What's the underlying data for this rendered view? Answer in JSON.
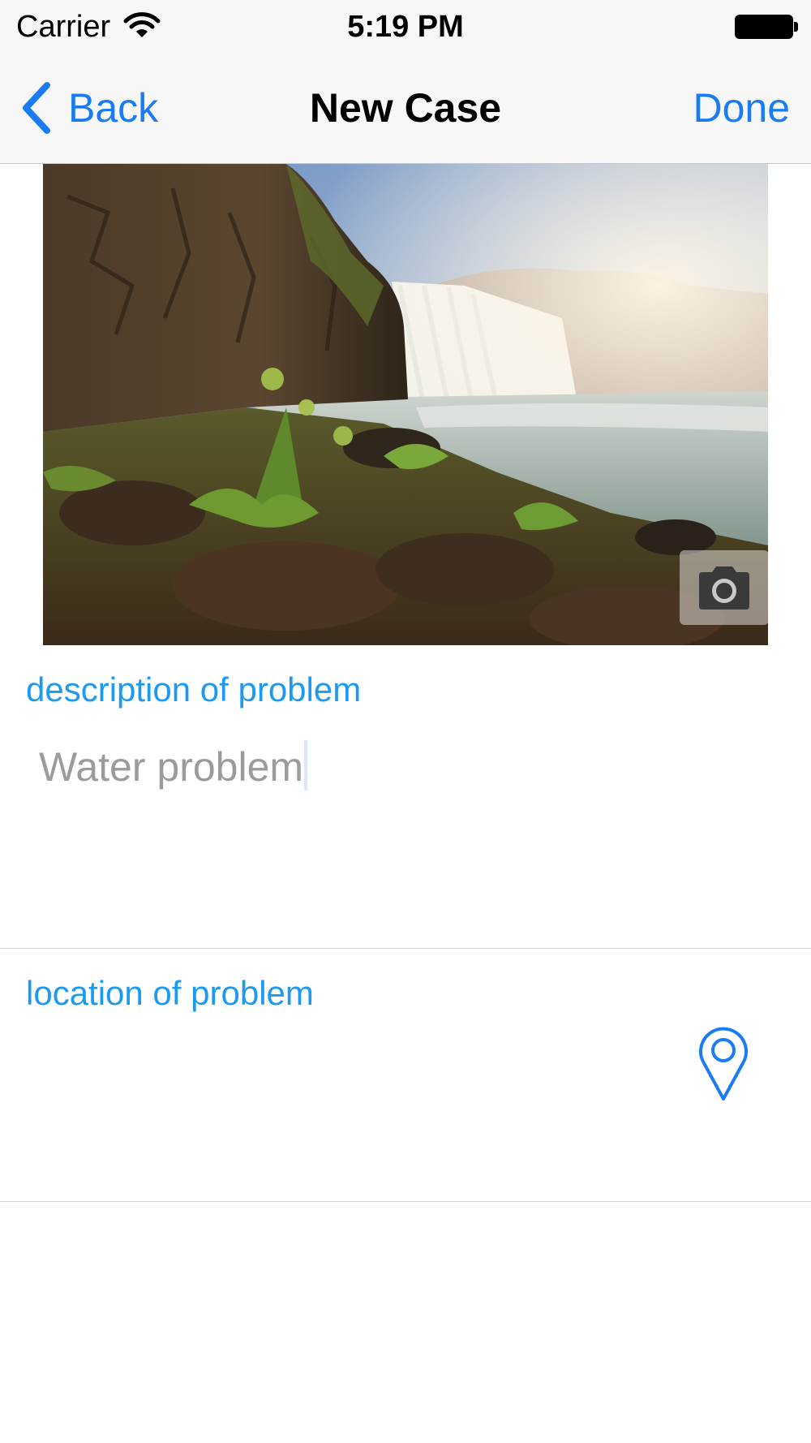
{
  "status_bar": {
    "carrier": "Carrier",
    "time": "5:19 PM",
    "icons": [
      "wifi-icon",
      "battery-icon"
    ]
  },
  "nav": {
    "back_label": "Back",
    "title": "New Case",
    "done_label": "Done"
  },
  "photo": {
    "icon": "camera-icon"
  },
  "description": {
    "label": "description of problem",
    "value": "Water problem"
  },
  "location": {
    "label": "location of problem",
    "icon": "map-pin-icon"
  },
  "colors": {
    "accent": "#1a7cf5",
    "section_label": "#1b9af0",
    "placeholder_text": "#9b9b9b"
  }
}
